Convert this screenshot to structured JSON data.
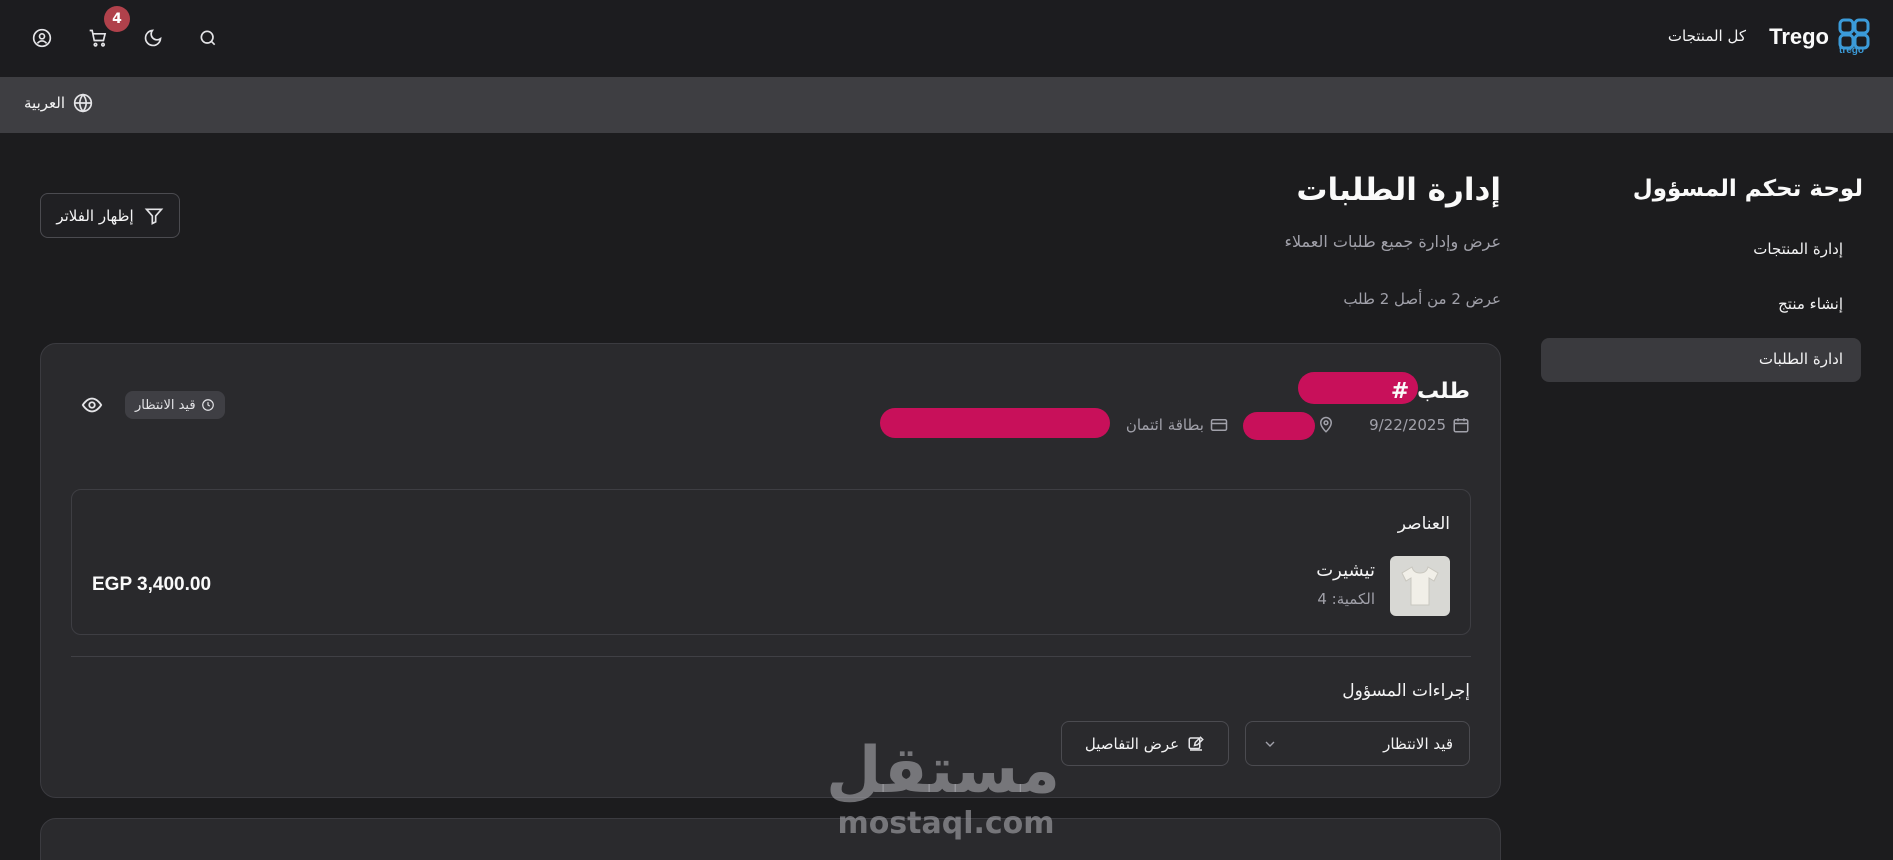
{
  "header": {
    "brand_name": "Trego",
    "brand_sub": "trego",
    "nav_all_products": "كل المنتجات",
    "cart_count": "4"
  },
  "langbar": {
    "language": "العربية"
  },
  "sidebar": {
    "title": "لوحة تحكم المسؤول",
    "items": [
      {
        "label": "إدارة المنتجات"
      },
      {
        "label": "إنشاء منتج"
      },
      {
        "label": "ادارة الطلبات",
        "active": true
      }
    ]
  },
  "main": {
    "title": "إدارة الطلبات",
    "subtitle": "عرض وإدارة جميع طلبات العملاء",
    "count_text": "عرض 2 من أصل 2 طلب",
    "filter_button": "إظهار الفلاتر"
  },
  "order": {
    "title": "طلب #",
    "date": "9/22/2025",
    "payment": "بطاقة ائتمان",
    "status": "قيد الانتظار",
    "items_label": "العناصر",
    "product": {
      "name": "تيشيرت",
      "quantity": "الكمية: 4",
      "price": "EGP 3,400.00"
    },
    "admin_actions_label": "إجراءات المسؤول",
    "status_select_value": "قيد الانتظار",
    "view_details": "عرض التفاصيل"
  },
  "watermark": {
    "arabic": "مستقل",
    "latin": "mostaql.com"
  },
  "colors": {
    "background": "#1c1c1e",
    "card": "#2a2a2d",
    "badge": "#b0414b",
    "redaction": "#c8105a",
    "brand_blue": "#3b9bd9"
  }
}
